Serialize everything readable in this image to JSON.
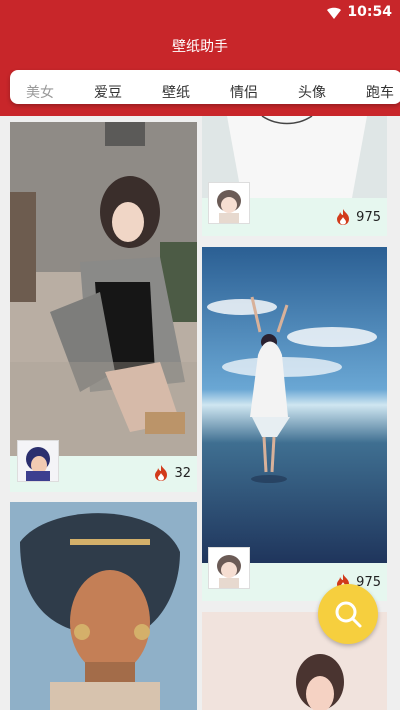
{
  "status": {
    "time": "10:54"
  },
  "appbar": {
    "title": "壁纸助手"
  },
  "tabs": [
    {
      "label": "美女"
    },
    {
      "label": "爱豆"
    },
    {
      "label": "壁纸"
    },
    {
      "label": "情侣"
    },
    {
      "label": "头像"
    },
    {
      "label": "跑车"
    }
  ],
  "cards": [
    {
      "heat": "32"
    },
    {
      "heat": "975"
    },
    {
      "heat": "975"
    }
  ],
  "colors": {
    "primary": "#c8262a",
    "meta_bg": "#e6f7ef",
    "fab": "#f6cf3e"
  },
  "icons": {
    "heat": "flame-icon",
    "search": "search-icon"
  }
}
